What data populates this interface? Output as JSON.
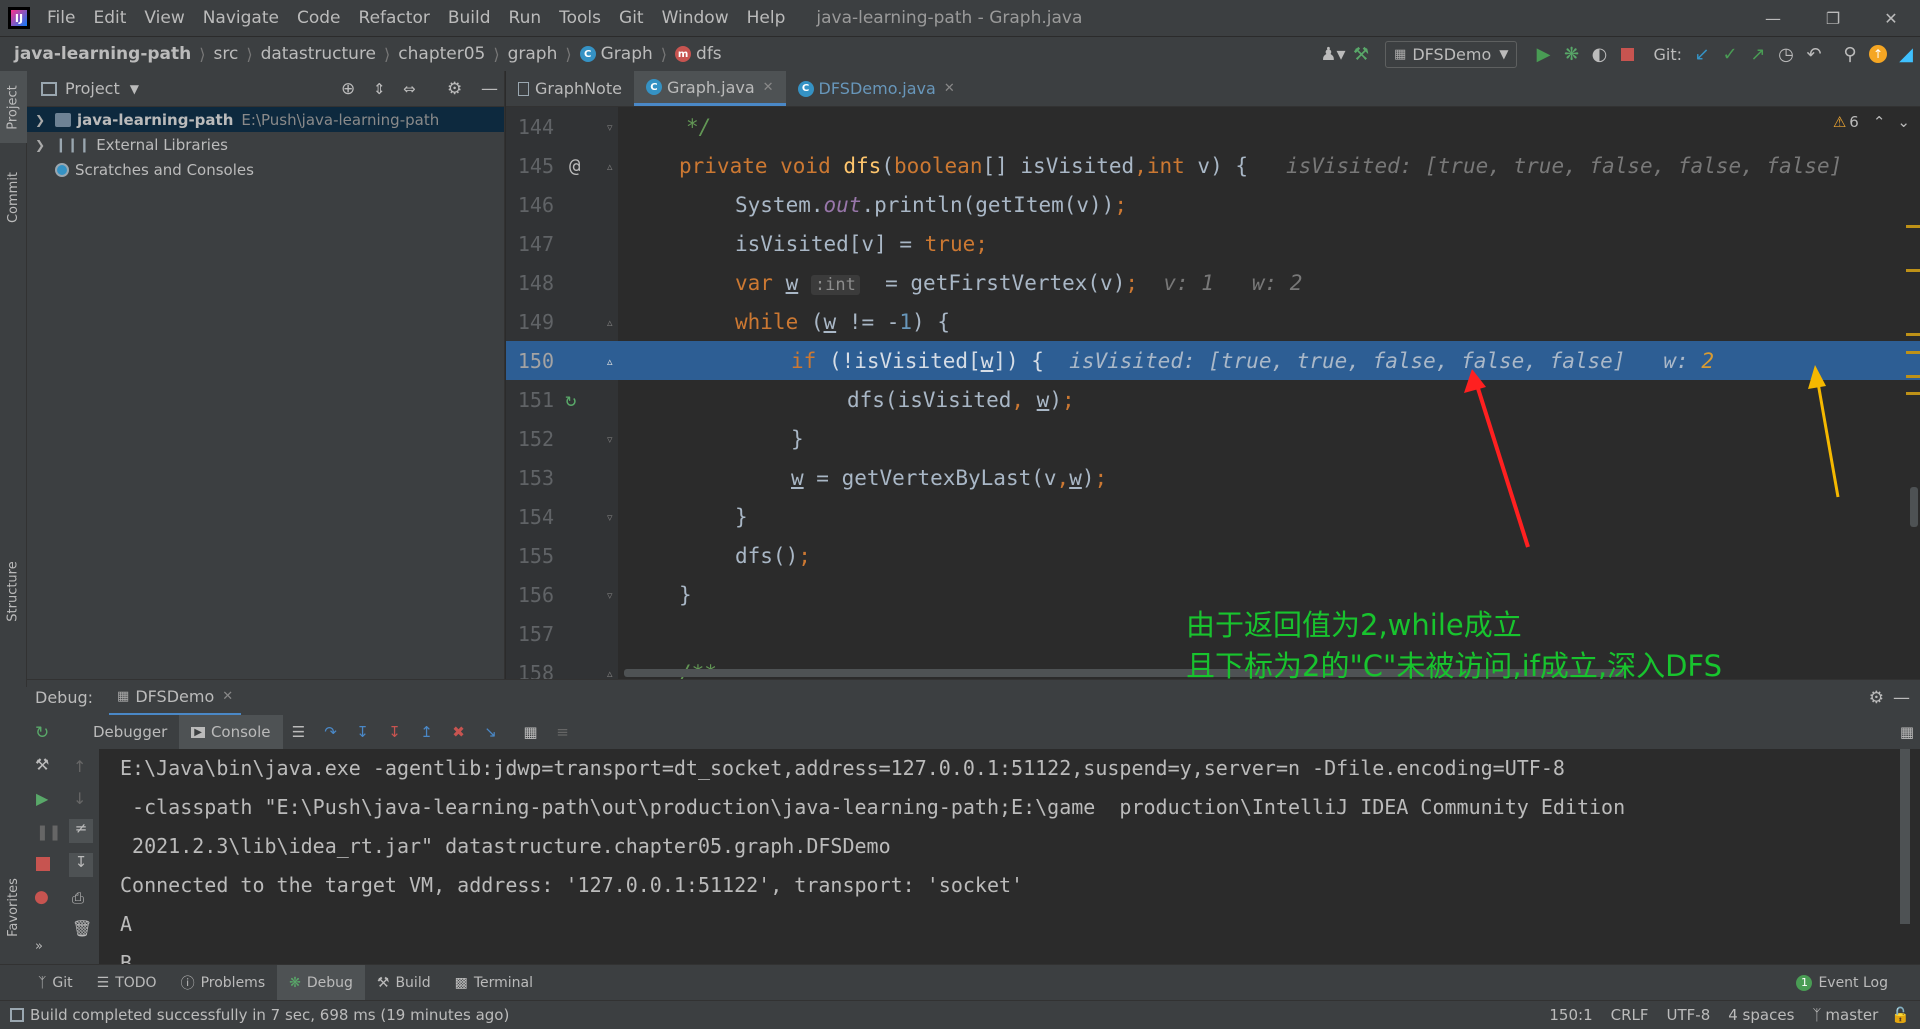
{
  "title_bar": {
    "menus": [
      "File",
      "Edit",
      "View",
      "Navigate",
      "Code",
      "Refactor",
      "Build",
      "Run",
      "Tools",
      "Git",
      "Window",
      "Help"
    ],
    "window_title": "java-learning-path - Graph.java"
  },
  "breadcrumb": [
    "java-learning-path",
    "src",
    "datastructure",
    "chapter05",
    "graph",
    "Graph",
    "dfs"
  ],
  "toolbar": {
    "run_config": "DFSDemo",
    "git_label": "Git:"
  },
  "left_stripe": {
    "project": "Project",
    "commit": "Commit",
    "structure": "Structure",
    "favorites": "Favorites"
  },
  "project_panel": {
    "title": "Project",
    "tree": [
      {
        "label": "java-learning-path",
        "path": "E:\\Push\\java-learning-path"
      },
      {
        "label": "External Libraries"
      },
      {
        "label": "Scratches and Consoles"
      }
    ]
  },
  "editor_tabs": [
    "GraphNote",
    "Graph.java",
    "DFSDemo.java"
  ],
  "inspections": {
    "warnings": "6"
  },
  "code_lines": [
    {
      "n": "144"
    },
    {
      "n": "145"
    },
    {
      "n": "146"
    },
    {
      "n": "147"
    },
    {
      "n": "148"
    },
    {
      "n": "149"
    },
    {
      "n": "150"
    },
    {
      "n": "151"
    },
    {
      "n": "152"
    },
    {
      "n": "153"
    },
    {
      "n": "154"
    },
    {
      "n": "155"
    },
    {
      "n": "156"
    },
    {
      "n": "157"
    },
    {
      "n": "158"
    }
  ],
  "code": {
    "l144": "*/",
    "l145_hint": "isVisited: [true, true, false, false, false]",
    "l148_hint_v": "v: 1",
    "l148_hint_w": "w: 2",
    "l148_inlay": ":int",
    "l150_hint": "isVisited: [true, true, false, false, false]",
    "l150_hint_w_label": "w:",
    "l150_hint_w_val": "2"
  },
  "annotation": {
    "line1": "由于返回值为2,while成立",
    "line2": "且下标为2的\"C\"未被访问,if成立,深入DFS"
  },
  "debug": {
    "label": "Debug:",
    "session": "DFSDemo",
    "tabs": [
      "Debugger",
      "Console"
    ]
  },
  "console_lines": [
    "E:\\Java\\bin\\java.exe -agentlib:jdwp=transport=dt_socket,address=127.0.0.1:51122,suspend=y,server=n -Dfile.encoding=UTF-8",
    " -classpath \"E:\\Push\\java-learning-path\\out\\production\\java-learning-path;E:\\game  production\\IntelliJ IDEA Community Edition",
    " 2021.2.3\\lib\\idea_rt.jar\" datastructure.chapter05.graph.DFSDemo",
    "Connected to the target VM, address: '127.0.0.1:51122', transport: 'socket'",
    "A",
    "B"
  ],
  "bottom_tabs": [
    "Git",
    "TODO",
    "Problems",
    "Debug",
    "Build",
    "Terminal"
  ],
  "event_log": "Event Log",
  "status": {
    "message": "Build completed successfully in 7 sec, 698 ms (19 minutes ago)",
    "position": "150:1",
    "line_sep": "CRLF",
    "encoding": "UTF-8",
    "indent": "4 spaces",
    "branch": "master"
  },
  "colors": {
    "keyword": "#cc7832",
    "method": "#ffc66d",
    "highlight": "#2d5e94",
    "annotation": "#18c42e",
    "arrow_red": "#ff2020",
    "arrow_yellow": "#f5b800"
  }
}
